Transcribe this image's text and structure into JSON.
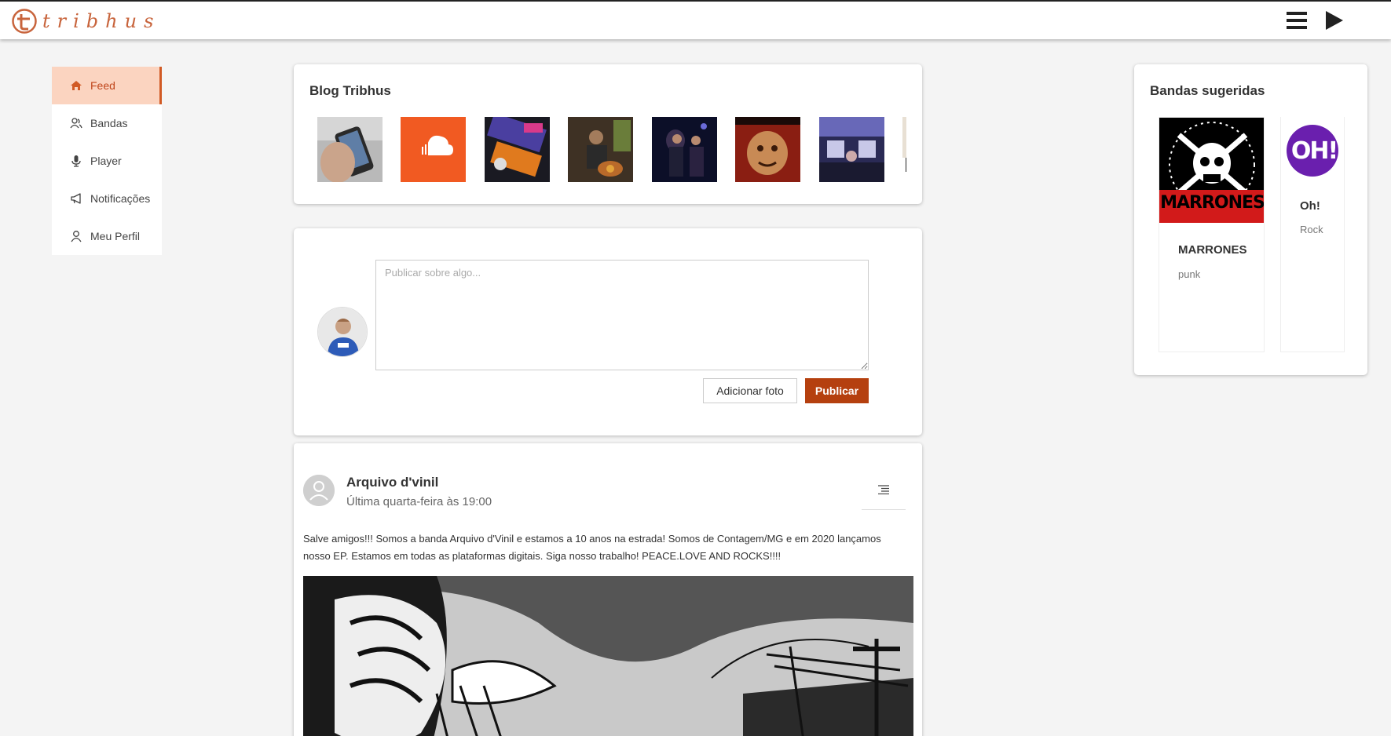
{
  "header": {
    "brand": "tribhus",
    "colors": {
      "brand": "#c8643c",
      "accent": "#b5400f"
    }
  },
  "sidebar": {
    "items": [
      {
        "label": "Feed",
        "icon": "home-icon",
        "active": true
      },
      {
        "label": "Bandas",
        "icon": "bands-icon"
      },
      {
        "label": "Player",
        "icon": "microphone-icon"
      },
      {
        "label": "Notificações",
        "icon": "megaphone-icon"
      },
      {
        "label": "Meu Perfil",
        "icon": "user-icon"
      }
    ]
  },
  "blog": {
    "title": "Blog Tribhus"
  },
  "composer": {
    "placeholder": "Publicar sobre algo...",
    "add_photo_label": "Adicionar foto",
    "publish_label": "Publicar"
  },
  "post": {
    "author": "Arquivo d'vinil",
    "time": "Última quarta-feira às 19:00",
    "text": "Salve amigos!!! Somos a banda Arquivo d'Vinil e estamos a 10 anos na estrada! Somos de Contagem/MG e em 2020 lançamos nosso EP. Estamos em todas as plataformas digitais. Siga nosso trabalho! PEACE.LOVE AND ROCKS!!!!"
  },
  "suggested": {
    "title": "Bandas sugeridas",
    "bands": [
      {
        "name": "MARRONES",
        "genre": "punk",
        "logo_text": "MARRONES"
      },
      {
        "name": "Oh!",
        "genre": "Rock",
        "logo_text": "OH!"
      }
    ]
  }
}
